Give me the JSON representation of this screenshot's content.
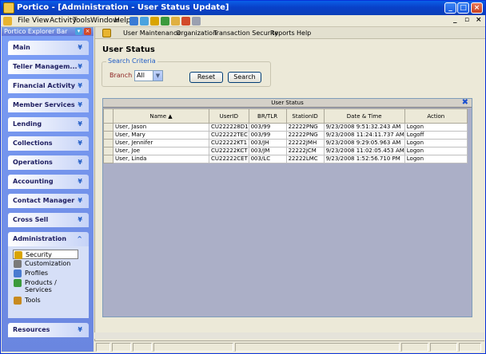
{
  "window": {
    "title": "Portico - [Administration - User Status Update]",
    "colors": {
      "titlebar": "#0a5fe8",
      "sidebar": "#6a86e0",
      "grid_bg": "#abafc7",
      "legend": "#215dc6"
    }
  },
  "menubar": {
    "items": [
      "File",
      "View",
      "Activity",
      "Tools",
      "Window",
      "Help"
    ]
  },
  "explorer": {
    "title": "Portico Explorer Bar",
    "groups": [
      {
        "label": "Main"
      },
      {
        "label": "Teller Managem..."
      },
      {
        "label": "Financial Activity"
      },
      {
        "label": "Member Services"
      },
      {
        "label": "Lending"
      },
      {
        "label": "Collections"
      },
      {
        "label": "Operations"
      },
      {
        "label": "Accounting"
      },
      {
        "label": "Contact Manager"
      },
      {
        "label": "Cross Sell"
      },
      {
        "label": "Administration"
      },
      {
        "label": "Resources"
      }
    ],
    "admin_items": [
      {
        "label": "Security",
        "icon": "key-icon"
      },
      {
        "label": "Customization",
        "icon": "gear-icon"
      },
      {
        "label": "Profiles",
        "icon": "profile-icon"
      },
      {
        "label": "Products /\nServices",
        "icon": "products-icon"
      },
      {
        "label": "Tools",
        "icon": "toolbox-icon"
      }
    ]
  },
  "app_menu": {
    "items": [
      "User Maintenance",
      "Organization",
      "Transaction Security",
      "Reports",
      "Help"
    ]
  },
  "page": {
    "title": "User Status",
    "search": {
      "legend": "Search Criteria",
      "branch_label": "Branch",
      "branch_value": "All",
      "reset_label": "Reset",
      "search_label": "Search"
    }
  },
  "grid": {
    "caption": "User Status",
    "columns": [
      "Name",
      "UserID",
      "BR/TLR",
      "StationID",
      "Date & Time",
      "Action"
    ],
    "rows": [
      [
        "User, Jason",
        "CU222228D1",
        "003/99",
        "22222PNG",
        "9/23/2008 9:51:32.243 AM",
        "Logon"
      ],
      [
        "User, Mary",
        "CU22222TEC",
        "003/99",
        "22222PNG",
        "9/23/2008 11:24:11.737 AM",
        "Logoff"
      ],
      [
        "User, Jennifer",
        "CU22222KT1",
        "003/JH",
        "22222JMH",
        "9/23/2008 9:29:05.963 AM",
        "Logon"
      ],
      [
        "User, Joe",
        "CU22222KCT",
        "003/JM",
        "22222JCM",
        "9/23/2008 11:02:05.453 AM",
        "Logon"
      ],
      [
        "User, Linda",
        "CU22222CET",
        "003/LC",
        "22222LMC",
        "9/23/2008 1:52:56.710 PM",
        "Logon"
      ]
    ]
  }
}
